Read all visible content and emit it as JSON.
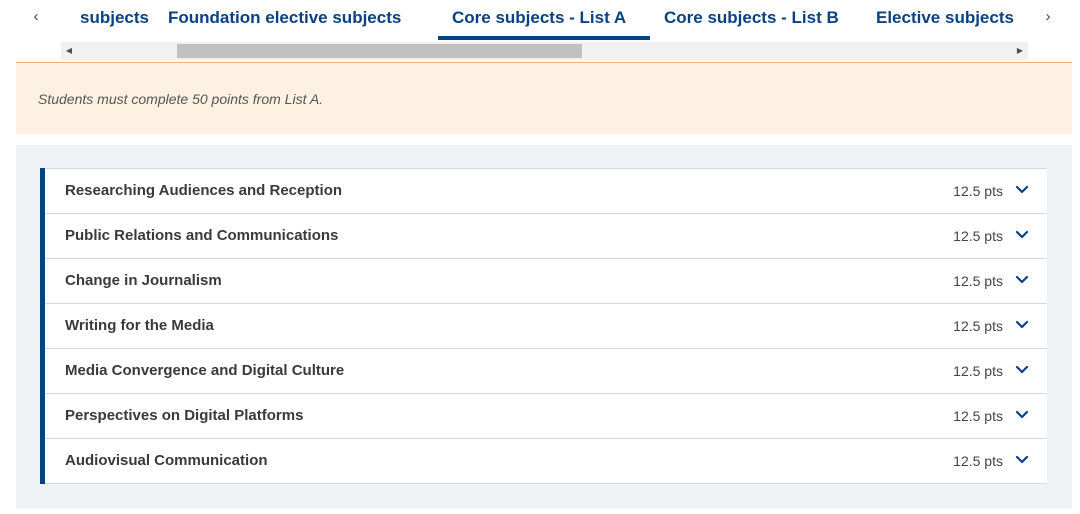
{
  "tabs": {
    "items": [
      {
        "label": "subjects"
      },
      {
        "label": "Foundation elective subjects"
      },
      {
        "label": "Core subjects - List A"
      },
      {
        "label": "Core subjects - List B"
      },
      {
        "label": "Elective subjects"
      }
    ],
    "active_index": 2,
    "prev_icon": "chevron-left-icon",
    "next_icon": "chevron-right-icon"
  },
  "scrollbar": {
    "left_icon": "triangle-left-icon",
    "right_icon": "triangle-right-icon"
  },
  "notice": {
    "text": "Students must complete 50 points from List A."
  },
  "subjects": [
    {
      "title": "Researching Audiences and Reception",
      "points": "12.5 pts"
    },
    {
      "title": "Public Relations and Communications",
      "points": "12.5 pts"
    },
    {
      "title": "Change in Journalism",
      "points": "12.5 pts"
    },
    {
      "title": "Writing for the Media",
      "points": "12.5 pts"
    },
    {
      "title": "Media Convergence and Digital Culture",
      "points": "12.5 pts"
    },
    {
      "title": "Perspectives on Digital Platforms",
      "points": "12.5 pts"
    },
    {
      "title": "Audiovisual Communication",
      "points": "12.5 pts"
    }
  ],
  "colors": {
    "brand": "#094183",
    "notice_bg": "#fdf1e1",
    "panel_bg": "#eef2f5"
  },
  "row_icon": "chevron-down-icon"
}
